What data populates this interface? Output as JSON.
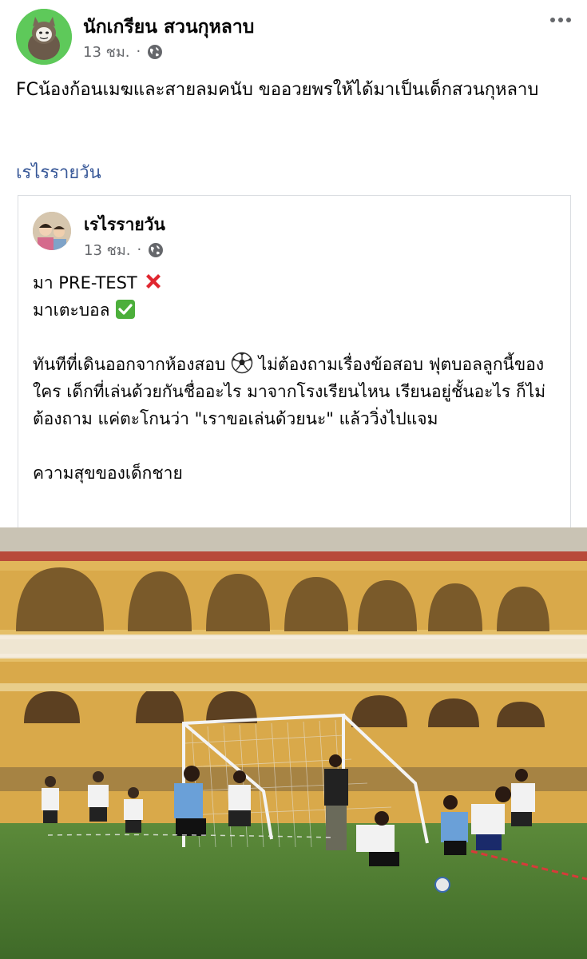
{
  "post": {
    "author": "นักเกรียน สวนกุหลาบ",
    "time": "13 ชม.",
    "dot": "·",
    "text": "FCน้องก้อนเมฆและสายลมคนับ ขออวยพรให้ได้มาเป็นเด็กสวนกุหลาบ",
    "page_link": "เรไรรายวัน",
    "more_icon": "more-options-icon",
    "audience_icon": "globe-icon"
  },
  "shared": {
    "author": "เรไรรายวัน",
    "time": "13 ชม.",
    "dot": "·",
    "line1": "มา PRE-TEST",
    "line2": "มาเตะบอล",
    "para_before_ball": "ทันทีที่เดินออกจากห้องสอบ",
    "para_after_ball": "ไม่ต้องถามเรื่องข้อสอบ ฟุตบอลลูกนี้ของใคร เด็กที่เล่นด้วยกันชื่ออะไร มาจากโรงเรียนไหน เรียนอยู่ชั้นอะไร ก็ไม่ต้องถาม แค่ตะโกนว่า \"เราขอเล่นด้วยนะ\" แล้ววิ่งไปแจม",
    "closing": "ความสุขของเด็กชาย",
    "emoji_line1": "cross-mark-icon",
    "emoji_line2": "check-mark-icon",
    "emoji_para": "soccer-ball-icon"
  },
  "colors": {
    "link": "#385898",
    "meta": "#65676b",
    "building": "#d9a94a",
    "grass": "#4f7d32"
  }
}
